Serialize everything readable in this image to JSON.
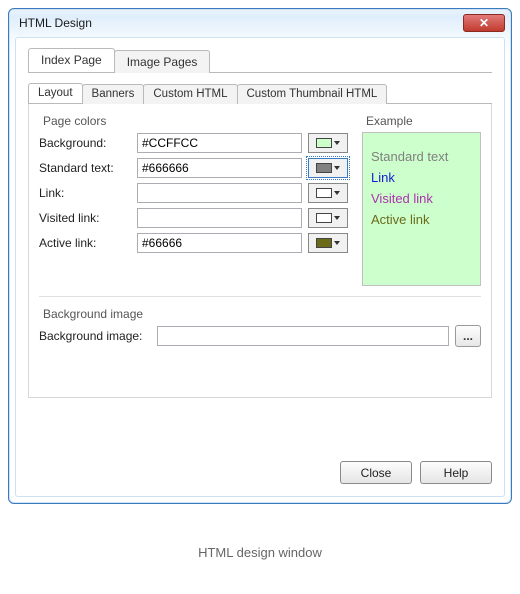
{
  "window": {
    "title": "HTML Design"
  },
  "mainTabs": {
    "t0": "Index Page",
    "t1": "Image Pages"
  },
  "subTabs": {
    "s0": "Layout",
    "s1": "Banners",
    "s2": "Custom HTML",
    "s3": "Custom Thumbnail HTML"
  },
  "groups": {
    "pageColors": "Page colors",
    "example": "Example",
    "bgImage": "Background image"
  },
  "labels": {
    "background": "Background:",
    "standardText": "Standard text:",
    "link": "Link:",
    "visitedLink": "Visited link:",
    "activeLink": "Active link:",
    "backgroundImage": "Background image:"
  },
  "values": {
    "background": "#CCFFCC",
    "standardText": "#666666",
    "link": "",
    "visitedLink": "",
    "activeLink": "#66666"
  },
  "swatchColors": {
    "background": "#CCFFCC",
    "standardText": "#808080",
    "link": "#ffffff",
    "visitedLink": "#ffffff",
    "activeLink": "#6b6b1a"
  },
  "example": {
    "bg": "#CCFFCC",
    "lines": {
      "std": {
        "text": "Standard text",
        "color": "#808080"
      },
      "link": {
        "text": "Link",
        "color": "#1a1ad6"
      },
      "vlink": {
        "text": "Visited link",
        "color": "#b030b0"
      },
      "alink": {
        "text": "Active link",
        "color": "#6b6b1a"
      }
    }
  },
  "buttons": {
    "close": "Close",
    "help": "Help",
    "browse": "..."
  },
  "caption": "HTML design window"
}
